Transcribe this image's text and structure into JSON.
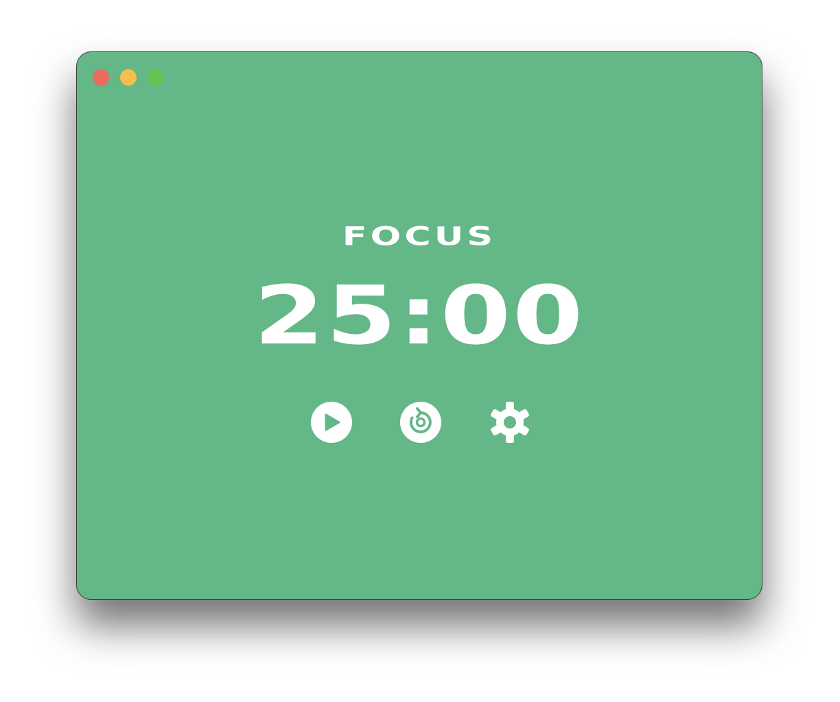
{
  "colors": {
    "background": "#64b787",
    "foreground": "#ffffff",
    "close": "#ec6a5e",
    "minimize": "#f4bf4f",
    "maximize": "#61c554"
  },
  "window_controls": [
    "close-dot",
    "minimize-dot",
    "maximize-dot"
  ],
  "mode": {
    "label": "FOCUS"
  },
  "timer": {
    "display": "25:00"
  },
  "controls": {
    "play": {
      "icon": "play-icon"
    },
    "reset": {
      "icon": "reset-icon"
    },
    "settings": {
      "icon": "gear-icon"
    }
  }
}
